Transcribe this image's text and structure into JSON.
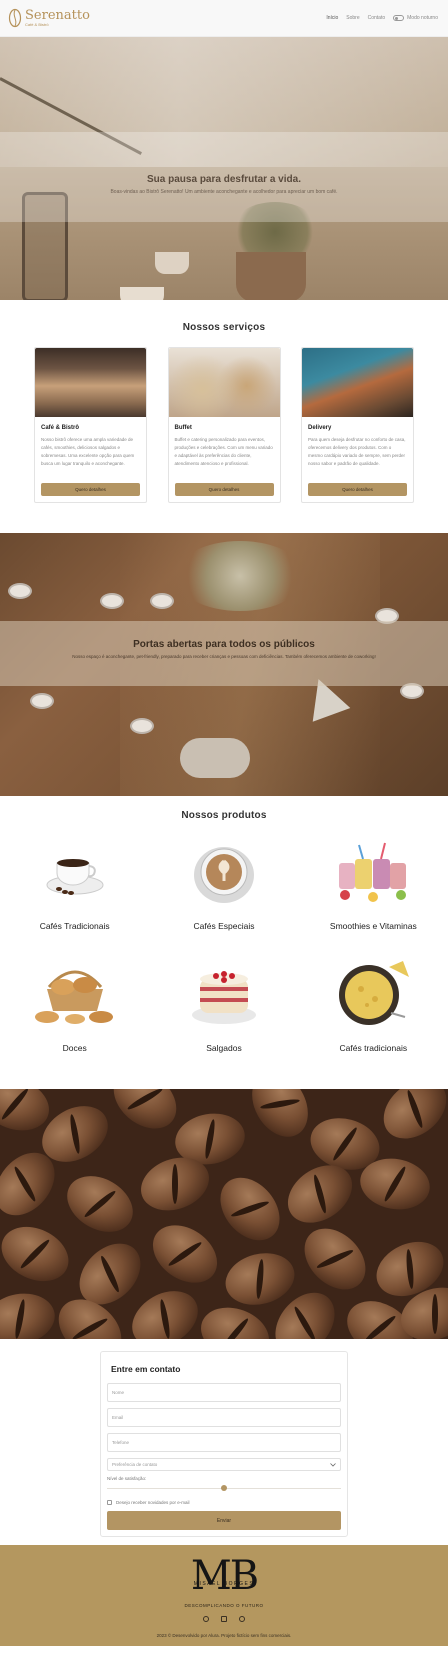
{
  "header": {
    "brand": "Serenatto",
    "brand_sub": "Café & Bistrô",
    "nav": [
      "Início",
      "Sobre",
      "Contato"
    ],
    "mode_label": "Modo noturno"
  },
  "hero": {
    "title": "Sua pausa para desfrutar a vida.",
    "subtitle": "Boas-vindas ao Bistrô Serenatto! Um ambiente aconchegante e acolhedor para apreciar um bom café."
  },
  "services": {
    "title": "Nossos serviços",
    "items": [
      {
        "title": "Café & Bistrô",
        "desc": "Nosso bistrô oferece uma ampla variedade de cafés, smoothies, deliciosos salgados e sobremesas. Uma excelente opção para quem busca um lugar tranquilo e aconchegante.",
        "button": "Quero detalhes"
      },
      {
        "title": "Buffet",
        "desc": "Buffet e catering personalizado para eventos, produções e celebrações. Com um menu variado e adaptável às preferências do cliente, atendimento atencioso e profissional.",
        "button": "Quero detalhes"
      },
      {
        "title": "Delivery",
        "desc": "Para quem deseja desfrutar no conforto de casa, oferecemos delivery dos produtos. Com o mesmo cardápio variado de sempre, sem perder nosso sabor e padrão de qualidade.",
        "button": "Quero detalhes"
      }
    ]
  },
  "doors": {
    "title": "Portas abertas para todos os públicos",
    "subtitle": "Nosso espaço é aconchegante, pet-friendly, preparado para receber crianças e pessoas com deficiências. Também oferecemos ambiente de coworking!"
  },
  "products": {
    "title": "Nossos produtos",
    "items": [
      "Cafés Tradicionais",
      "Cafés Especiais",
      "Smoothies e Vitaminas",
      "Doces",
      "Salgados",
      "Cafés tradicionais"
    ]
  },
  "contact": {
    "title": "Entre em contato",
    "name_placeholder": "Nome",
    "email_placeholder": "Email",
    "phone_placeholder": "Telefone",
    "preference": "Preferência de contato",
    "satisfaction_label": "Nível de satisfação:",
    "satisfaction_level": 0.5,
    "newsletter": "Desejo receber novidades por e-mail",
    "submit": "Enviar"
  },
  "footer": {
    "logo": "MB",
    "logo_name": "MISAEL BORGES",
    "tagline": "DESCOMPLICANDO O FUTURO",
    "copyright": "2023 © Desenvolvido por Alura. Projeto fictício sem fins comerciais."
  },
  "colors": {
    "accent": "#b39563",
    "footer": "#b4975f",
    "brand": "#b5925a"
  }
}
